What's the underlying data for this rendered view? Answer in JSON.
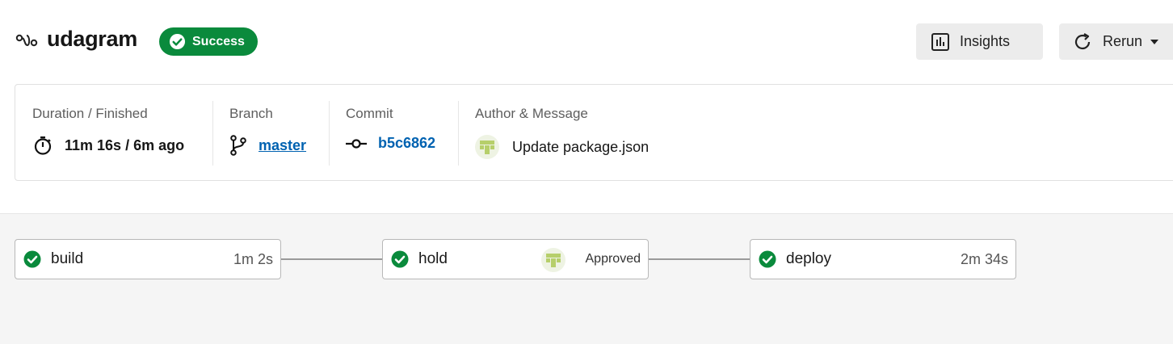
{
  "header": {
    "project_icon": "workflow-icon",
    "project_name": "udagram",
    "status": "Success",
    "status_color": "#0a8a3c",
    "insights_label": "Insights",
    "insights_icon": "bar-chart-icon",
    "rerun_label": "Rerun",
    "rerun_icon": "refresh-icon"
  },
  "meta": {
    "duration": {
      "label": "Duration / Finished",
      "value": "11m 16s / 6m ago",
      "icon": "stopwatch-icon"
    },
    "branch": {
      "label": "Branch",
      "value": "master",
      "icon": "git-branch-icon"
    },
    "commit": {
      "label": "Commit",
      "value": "b5c6862",
      "icon": "git-commit-icon"
    },
    "author": {
      "label": "Author & Message",
      "message": "Update package.json",
      "icon": "avatar"
    }
  },
  "jobs": [
    {
      "name": "build",
      "status": "success",
      "duration": "1m 2s"
    },
    {
      "name": "hold",
      "status": "success",
      "approval": "Approved"
    },
    {
      "name": "deploy",
      "status": "success",
      "duration": "2m 34s"
    }
  ],
  "colors": {
    "success": "#0a8a3c",
    "link": "#0062b1",
    "button_bg": "#ececec",
    "workflow_bg": "#f5f5f5"
  }
}
